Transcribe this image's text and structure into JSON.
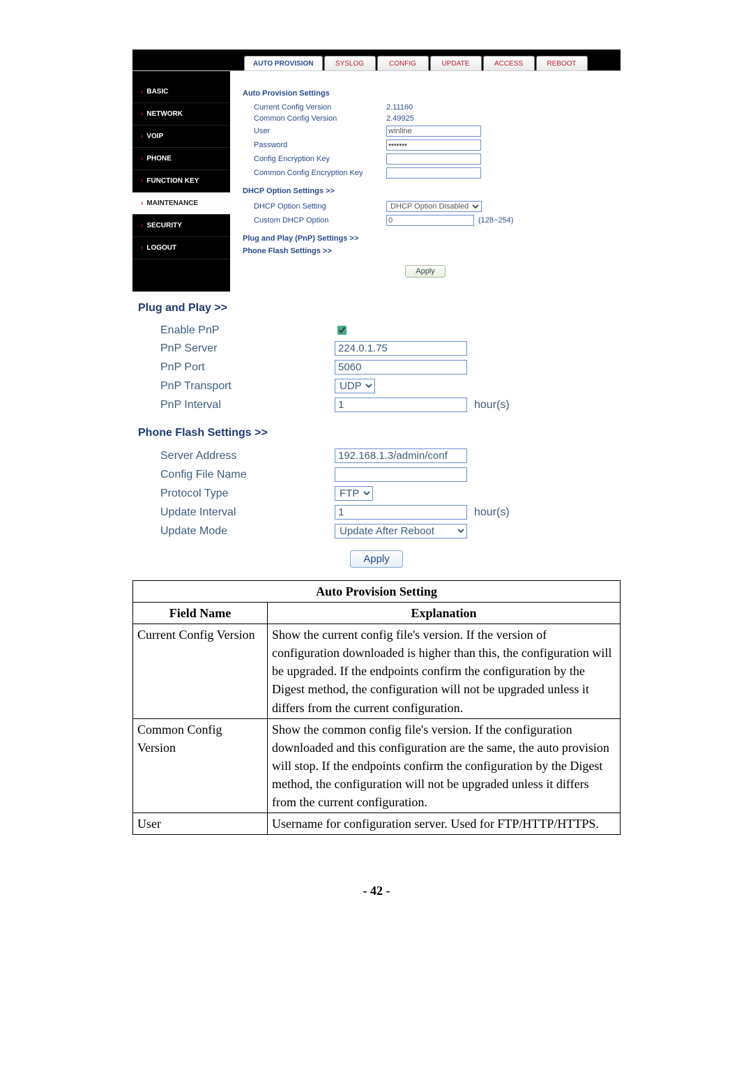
{
  "tabs": {
    "autoProvision": "AUTO PROVISION",
    "syslog": "SYSLOG",
    "config": "CONFIG",
    "update": "UPDATE",
    "access": "ACCESS",
    "reboot": "REBOOT"
  },
  "sidebar": {
    "basic": "BASIC",
    "network": "NETWORK",
    "voip": "VOIP",
    "phone": "PHONE",
    "functionKey": "FUNCTION KEY",
    "maintenance": "MAINTENANCE",
    "security": "SECURITY",
    "logout": "LOGOUT"
  },
  "autoProv": {
    "sectionTitle": "Auto Provision Settings",
    "currentConfigVersionLabel": "Current Config Version",
    "currentConfigVersionValue": "2.11160",
    "commonConfigVersionLabel": "Common Config Version",
    "commonConfigVersionValue": "2.49925",
    "userLabel": "User",
    "userValue": "winline",
    "passwordLabel": "Password",
    "passwordValue": "•••••••",
    "configEncKeyLabel": "Config Encryption Key",
    "configEncKeyValue": "",
    "commonConfigEncKeyLabel": "Common Config Encryption Key",
    "commonConfigEncKeyValue": ""
  },
  "dhcp": {
    "sectionTitle": "DHCP Option Settings >>",
    "optionSettingLabel": "DHCP Option Setting",
    "optionSettingValue": "DHCP Option Disabled",
    "customOptionLabel": "Custom DHCP Option",
    "customOptionValue": "0",
    "customOptionRange": "(128~254)"
  },
  "collapsed": {
    "pnpTitle": "Plug and Play (PnP) Settings >>",
    "flashTitle": "Phone Flash Settings >>"
  },
  "applyLabel": "Apply",
  "pnp": {
    "sectionTitle": "Plug and Play >>",
    "enableLabel": "Enable PnP",
    "serverLabel": "PnP Server",
    "serverValue": "224.0.1.75",
    "portLabel": "PnP Port",
    "portValue": "5060",
    "transportLabel": "PnP Transport",
    "transportValue": "UDP",
    "intervalLabel": "PnP Interval",
    "intervalValue": "1",
    "intervalUnit": "hour(s)"
  },
  "flash": {
    "sectionTitle": "Phone Flash Settings >>",
    "serverAddrLabel": "Server Address",
    "serverAddrValue": "192.168.1.3/admin/conf",
    "configFileLabel": "Config File Name",
    "configFileValue": "",
    "protocolLabel": "Protocol Type",
    "protocolValue": "FTP",
    "updateIntervalLabel": "Update Interval",
    "updateIntervalValue": "1",
    "updateIntervalUnit": "hour(s)",
    "updateModeLabel": "Update Mode",
    "updateModeValue": "Update After Reboot"
  },
  "table": {
    "title": "Auto Provision Setting",
    "fieldHeader": "Field Name",
    "explHeader": "Explanation",
    "rows": [
      {
        "field": "Current Config Version",
        "expl": "Show the current config file's version. If the version of configuration downloaded is higher than this, the configuration will be upgraded. If the endpoints confirm the configuration by the Digest method, the configuration will not be upgraded unless it differs from the current configuration."
      },
      {
        "field": "Common Config Version",
        "expl": "Show the common config file's version. If the configuration downloaded and this configuration are the same, the auto provision will stop. If the endpoints confirm the configuration by the Digest method, the configuration will not be upgraded unless it differs from the current configuration."
      },
      {
        "field": "User",
        "expl": "Username for configuration server.   Used for FTP/HTTP/HTTPS."
      }
    ]
  },
  "pageNumber": "- 42 -"
}
